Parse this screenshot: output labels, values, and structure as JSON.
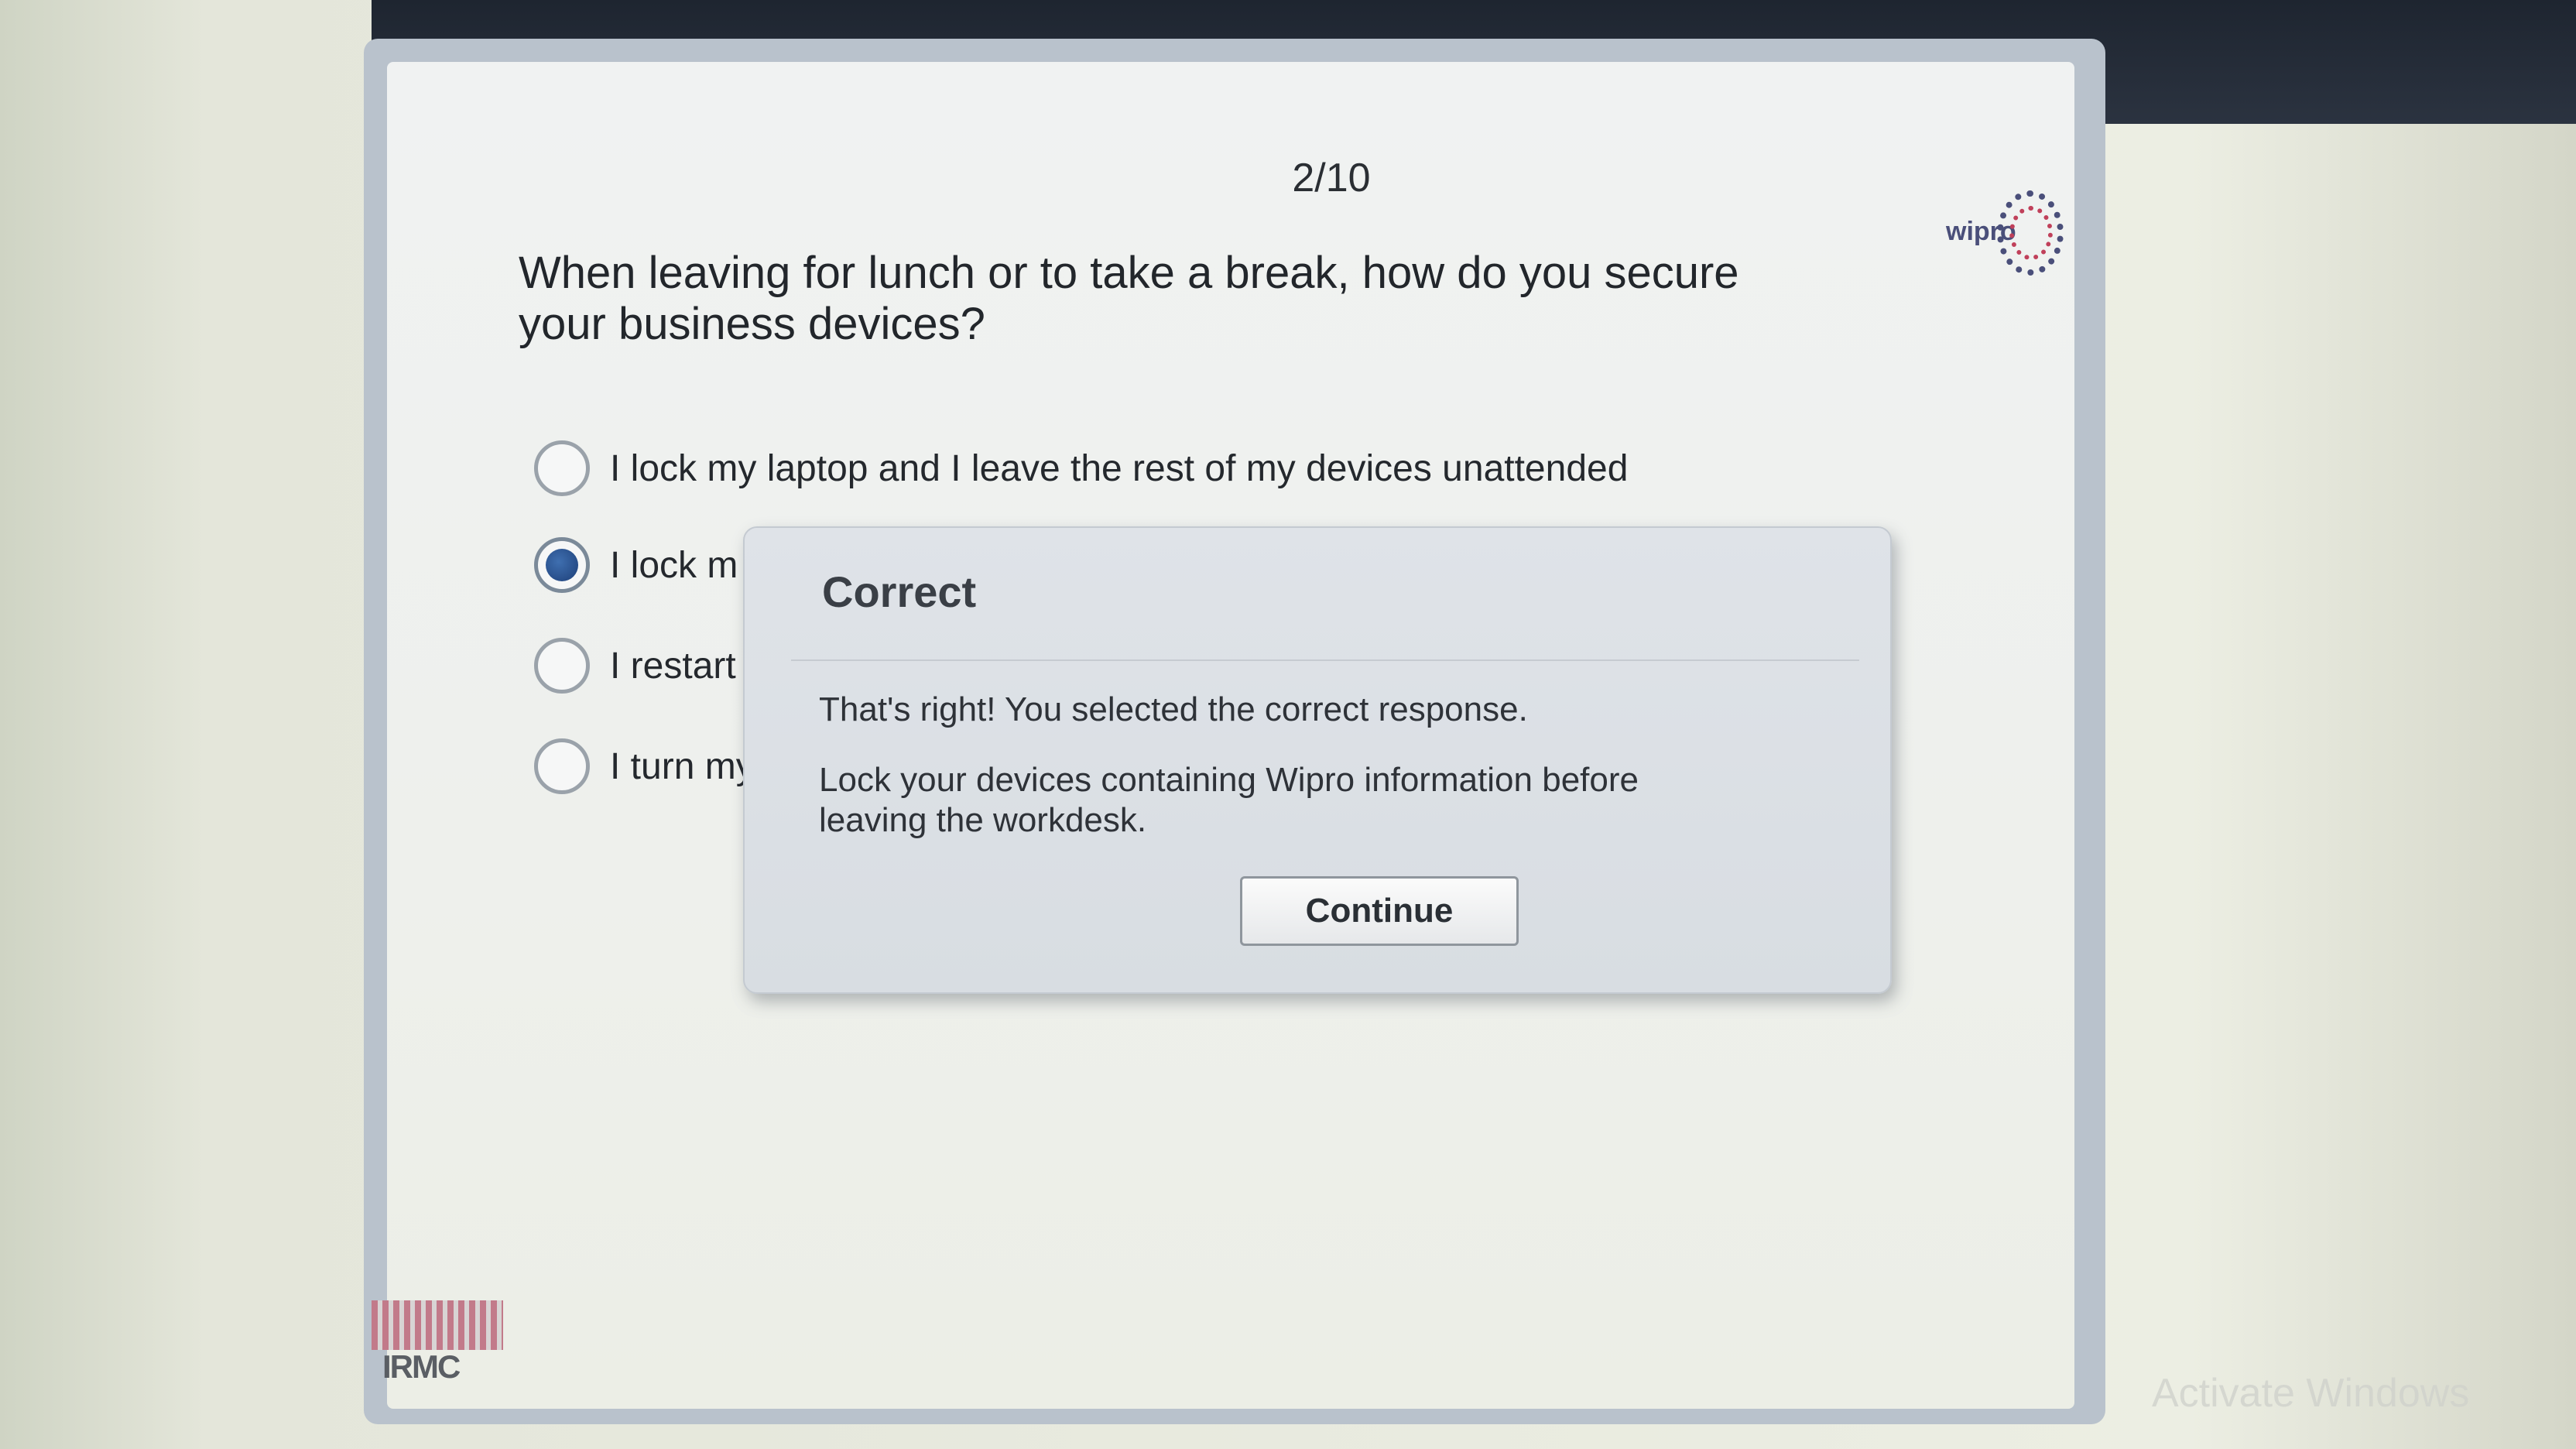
{
  "header": {
    "counter": "2/10",
    "logo_text": "wipro"
  },
  "question": {
    "text": "When leaving for lunch or to take a break, how do you secure your business devices?"
  },
  "options": [
    {
      "label": "I lock my laptop and I leave the rest of my devices unattended",
      "selected": false
    },
    {
      "label": "I lock m",
      "selected": true
    },
    {
      "label": "I restart",
      "selected": false
    },
    {
      "label": "I turn my",
      "selected": false
    }
  ],
  "feedback": {
    "title": "Correct",
    "message": "That's right!  You selected the correct response.",
    "explanation": "Lock your devices containing Wipro information before leaving the workdesk.",
    "continue_label": "Continue"
  },
  "footer": {
    "brand": "IRMC"
  },
  "os": {
    "watermark": "Activate Windows"
  },
  "colors": {
    "selected_radio": "#2a559a",
    "modal_bg": "#dadfe4",
    "logo": "#4a4f7a"
  }
}
